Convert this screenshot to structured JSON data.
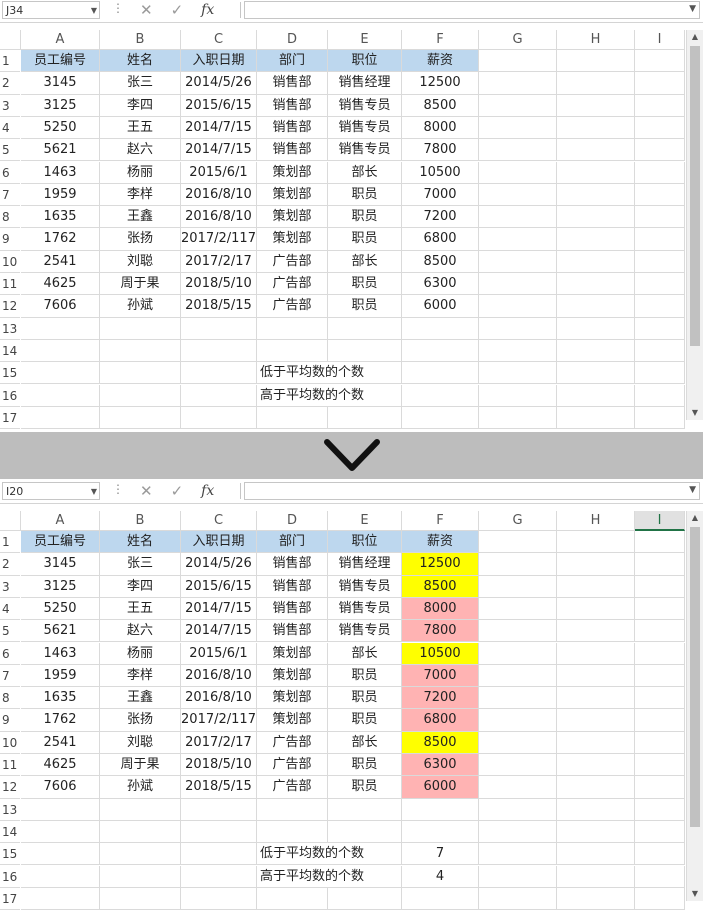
{
  "top": {
    "name_box": "J34",
    "formula": "",
    "fx_label": "fx",
    "grid": {
      "columns": [
        "A",
        "B",
        "C",
        "D",
        "E",
        "F",
        "G",
        "H",
        "I"
      ],
      "rows": [
        [
          "员工编号",
          "姓名",
          "入职日期",
          "部门",
          "职位",
          "薪资"
        ],
        [
          "3145",
          "张三",
          "2014/5/26",
          "销售部",
          "销售经理",
          "12500"
        ],
        [
          "3125",
          "李四",
          "2015/6/15",
          "销售部",
          "销售专员",
          "8500"
        ],
        [
          "5250",
          "王五",
          "2014/7/15",
          "销售部",
          "销售专员",
          "8000"
        ],
        [
          "5621",
          "赵六",
          "2014/7/15",
          "销售部",
          "销售专员",
          "7800"
        ],
        [
          "1463",
          "杨丽",
          "2015/6/1",
          "策划部",
          "部长",
          "10500"
        ],
        [
          "1959",
          "李样",
          "2016/8/10",
          "策划部",
          "职员",
          "7000"
        ],
        [
          "1635",
          "王鑫",
          "2016/8/10",
          "策划部",
          "职员",
          "7200"
        ],
        [
          "1762",
          "张扬",
          "2017/2/117",
          "策划部",
          "职员",
          "6800"
        ],
        [
          "2541",
          "刘聪",
          "2017/2/17",
          "广告部",
          "部长",
          "8500"
        ],
        [
          "4625",
          "周于果",
          "2018/5/10",
          "广告部",
          "职员",
          "6300"
        ],
        [
          "7606",
          "孙斌",
          "2018/5/15",
          "广告部",
          "职员",
          "6000"
        ]
      ],
      "row_numbers": [
        "1",
        "2",
        "3",
        "4",
        "5",
        "6",
        "7",
        "8",
        "9",
        "10",
        "11",
        "12",
        "13",
        "14",
        "15",
        "16",
        "17"
      ],
      "summary": [
        {
          "label": "低于平均数的个数",
          "value": ""
        },
        {
          "label": "高于平均数的个数",
          "value": ""
        }
      ]
    }
  },
  "bottom": {
    "name_box": "I20",
    "formula": "",
    "fx_label": "fx",
    "selected_column": "I",
    "summary": [
      {
        "label": "低于平均数的个数",
        "value": "7"
      },
      {
        "label": "高于平均数的个数",
        "value": "4"
      }
    ],
    "salary_highlight": [
      "above",
      "above",
      "below",
      "below",
      "above",
      "below",
      "below",
      "below",
      "above",
      "below",
      "below"
    ]
  },
  "colors": {
    "header_fill": "#bdd7ee",
    "above_avg": "#ffff00",
    "below_avg": "#ffb3b3",
    "selected_header": "#217346"
  },
  "icons": {
    "cancel": "✕",
    "enter": "✓",
    "chevron": "chevron-down-icon"
  }
}
